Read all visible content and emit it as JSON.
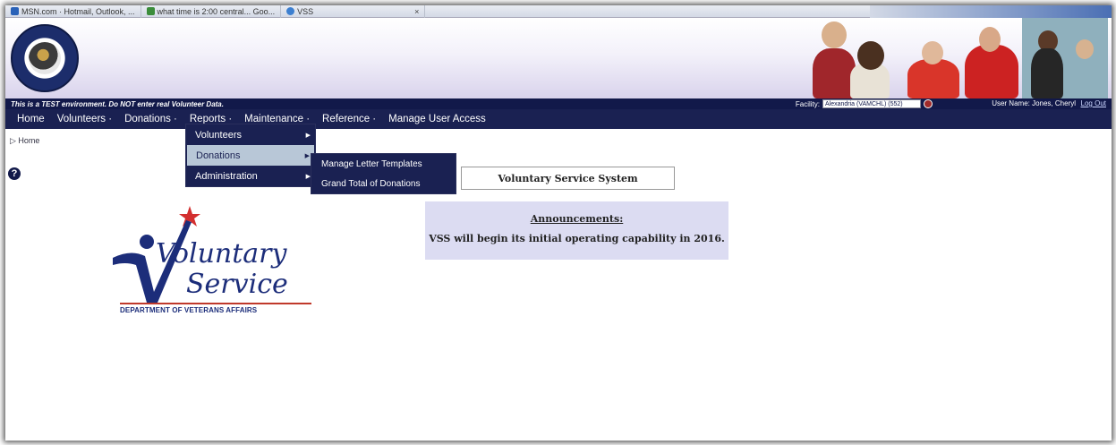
{
  "browser": {
    "tabs": [
      {
        "label": "MSN.com · Hotmail, Outlook, ..."
      },
      {
        "label": "what time is 2:00 central... Goo..."
      },
      {
        "label": "VSS"
      }
    ],
    "close_glyph": "×"
  },
  "header": {
    "warning": "This is a TEST environment. Do NOT enter real Volunteer Data.",
    "facility_label": "Facility:",
    "facility_value": "Alexandria (VAMCHL) (552)",
    "user_label": "User Name: Jones, Cheryl",
    "logout": "Log Out"
  },
  "nav": {
    "items": [
      {
        "label": "Home"
      },
      {
        "label": "Volunteers ·"
      },
      {
        "label": "Donations ·"
      },
      {
        "label": "Reports ·"
      },
      {
        "label": "Maintenance ·"
      },
      {
        "label": "Reference ·"
      },
      {
        "label": "Manage User Access"
      }
    ]
  },
  "reports_menu": {
    "items": [
      {
        "label": "Volunteers",
        "arrow": "▶"
      },
      {
        "label": "Donations",
        "arrow": "▶"
      },
      {
        "label": "Administration",
        "arrow": "▶"
      }
    ]
  },
  "donations_submenu": {
    "items": [
      {
        "label": "Manage Letter Templates"
      },
      {
        "label": "Grand Total of Donations"
      }
    ]
  },
  "breadcrumb": "▷ Home",
  "help_glyph": "?",
  "main": {
    "title": "Voluntary Service System",
    "announcements_heading": "Announcements:",
    "announcement_text": "VSS will begin its initial operating capability in 2016."
  },
  "logo": {
    "line1": "Voluntary",
    "line2": "Service",
    "subtitle": "DEPARTMENT OF VETERANS AFFAIRS"
  },
  "colors": {
    "nav_bg": "#1a2152",
    "highlight": "#b8c7d7",
    "announce_bg": "#dcdcf2",
    "brand_blue": "#1c2d7a",
    "brand_red": "#c0392b"
  }
}
